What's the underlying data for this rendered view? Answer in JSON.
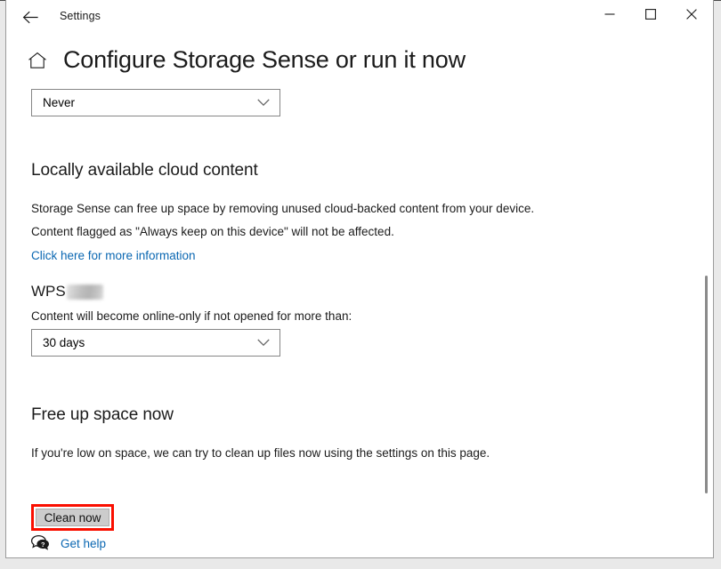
{
  "window": {
    "app_title": "Settings",
    "back_icon": "back-arrow-icon",
    "minimize_icon": "minimize-icon",
    "maximize_icon": "maximize-icon",
    "close_icon": "close-icon"
  },
  "page": {
    "home_icon": "home-icon",
    "title": "Configure Storage Sense or run it now"
  },
  "schedule": {
    "selected": "Never",
    "chevron_icon": "chevron-down-icon"
  },
  "cloud_content": {
    "heading": "Locally available cloud content",
    "description_line_1": "Storage Sense can free up space by removing unused cloud-backed content from your device.",
    "description_line_2": "Content flagged as \"Always keep on this device\" will not be affected.",
    "link": "Click here for more information",
    "account_name": "WPS",
    "account_name_redacted": true,
    "subheading": "Content will become online-only if not opened for more than:",
    "days_selected": "30 days",
    "days_chevron_icon": "chevron-down-icon"
  },
  "free_up_space": {
    "heading": "Free up space now",
    "description": "If you're low on space, we can try to clean up files now using the settings on this page.",
    "clean_button_label": "Clean now"
  },
  "footer": {
    "help_icon": "help-bubble-icon",
    "help_label": "Get help"
  },
  "scrollbar": {
    "thumb_icon": "scrollbar-thumb"
  },
  "colors": {
    "accent_link": "#0a67b2",
    "annotation_red": "#fa0f00",
    "top_accent": "#c9a227",
    "button_face": "#cccccc"
  }
}
